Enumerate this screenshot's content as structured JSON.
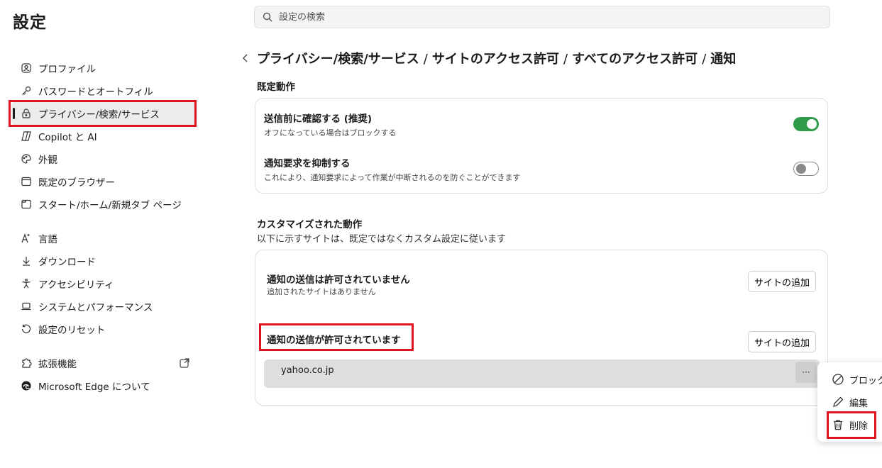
{
  "app": {
    "title": "設定"
  },
  "search": {
    "placeholder": "設定の検索"
  },
  "sidebar": {
    "items": [
      {
        "label": "プロファイル",
        "icon": "profile-icon"
      },
      {
        "label": "パスワードとオートフィル",
        "icon": "key-icon"
      },
      {
        "label": "プライバシー/検索/サービス",
        "icon": "lock-icon",
        "active": true
      },
      {
        "label": "Copilot と AI",
        "icon": "copilot-icon"
      },
      {
        "label": "外観",
        "icon": "palette-icon"
      },
      {
        "label": "既定のブラウザー",
        "icon": "browser-icon"
      },
      {
        "label": "スタート/ホーム/新規タブ ページ",
        "icon": "home-icon"
      },
      {
        "label": "言語",
        "icon": "language-icon"
      },
      {
        "label": "ダウンロード",
        "icon": "download-icon"
      },
      {
        "label": "アクセシビリティ",
        "icon": "accessibility-icon"
      },
      {
        "label": "システムとパフォーマンス",
        "icon": "laptop-icon"
      },
      {
        "label": "設定のリセット",
        "icon": "reset-icon"
      },
      {
        "label": "拡張機能",
        "icon": "puzzle-icon"
      },
      {
        "label": "Microsoft Edge について",
        "icon": "edge-icon"
      }
    ]
  },
  "main": {
    "breadcrumb": [
      "プライバシー/検索/サービス",
      "サイトのアクセス許可",
      "すべてのアクセス許可",
      "通知"
    ],
    "breadcrumb_separator": "/",
    "default_section": {
      "label": "既定動作",
      "rows": [
        {
          "title": "送信前に確認する (推奨)",
          "subtitle": "オフになっている場合はブロックする",
          "toggle": "on"
        },
        {
          "title": "通知要求を抑制する",
          "subtitle": "これにより、通知要求によって作業が中断されるのを防ぐことができます",
          "toggle": "off"
        }
      ]
    },
    "custom_section": {
      "label": "カスタマイズされた動作",
      "description": "以下に示すサイトは、既定ではなくカスタム設定に従います",
      "blocked": {
        "title": "通知の送信は許可されていません",
        "subtitle": "追加されたサイトはありません",
        "button": "サイトの追加"
      },
      "allowed": {
        "title": "通知の送信が許可されています",
        "button": "サイトの追加",
        "sites": [
          "yahoo.co.jp"
        ]
      },
      "more_label": "···"
    }
  },
  "context_menu": {
    "items": [
      {
        "label": "ブロック",
        "icon": "block-icon"
      },
      {
        "label": "編集",
        "icon": "pencil-icon"
      },
      {
        "label": "削除",
        "icon": "trash-icon"
      }
    ]
  },
  "colors": {
    "toggle_on": "#2f9c4a",
    "highlight": "#e0141e"
  }
}
